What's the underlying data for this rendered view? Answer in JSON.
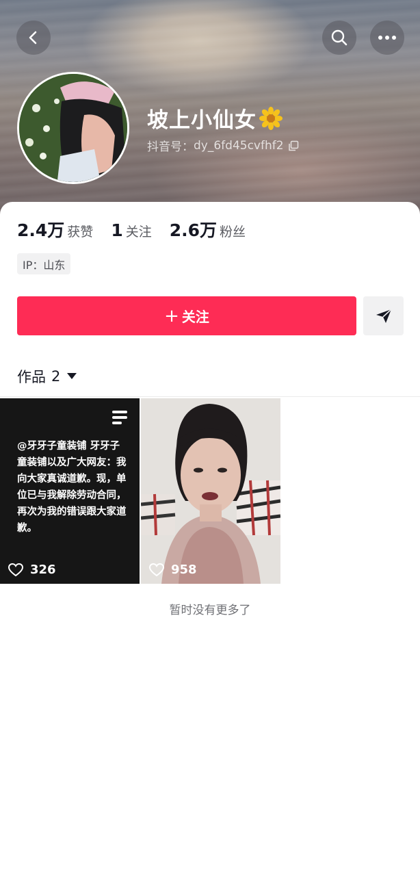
{
  "header": {
    "name": "坡上小仙女",
    "douyin_id_label": "抖音号：",
    "douyin_id": "dy_6fd45cvfhf2"
  },
  "stats": [
    {
      "value": "2.4万",
      "label": "获赞"
    },
    {
      "value": "1",
      "label": "关注"
    },
    {
      "value": "2.6万",
      "label": "粉丝"
    }
  ],
  "ip": "IP：山东",
  "follow_button": {
    "label": "关注"
  },
  "works": {
    "label": "作品",
    "count": "2"
  },
  "videos": [
    {
      "cover_text": "@牙牙子童装铺 牙牙子童装铺以及广大网友：我向大家真诚道歉。现，单位已与我解除劳动合同，再次为我的错误跟大家道歉。",
      "likes": "326"
    },
    {
      "likes": "958"
    }
  ],
  "footer": {
    "no_more": "暂时没有更多了"
  },
  "colors": {
    "accent": "#fe2c55",
    "text": "#161823",
    "muted": "#5b5c62"
  },
  "icons": [
    "back-icon",
    "search-icon",
    "more-icon",
    "flower-icon",
    "copy-icon",
    "share-icon",
    "caret-down-icon",
    "text-post-icon",
    "heart-icon"
  ]
}
